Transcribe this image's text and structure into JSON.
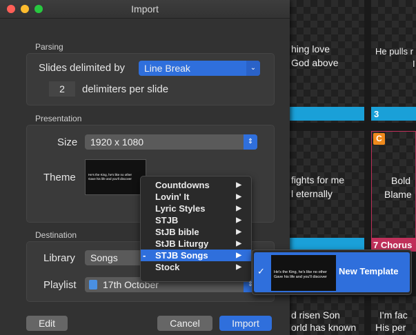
{
  "background": {
    "slides": [
      {
        "line1": "hing love",
        "line2": "God above"
      },
      {
        "line1": "He pulls r",
        "line2": "I"
      },
      {
        "line1": "fights for me",
        "line2": "l eternally"
      },
      {
        "line1": "Bold",
        "line2": "Blame"
      },
      {
        "line1": "d risen Son",
        "line2": "orld has known"
      },
      {
        "line1": "I'm fac",
        "line2": "His per"
      }
    ],
    "slide_number_3": "3",
    "badge_c": "C",
    "chorus_label": "7 Chorus"
  },
  "window": {
    "title": "Import"
  },
  "parsing": {
    "section": "Parsing",
    "slides_delimited_label": "Slides delimited by",
    "delimiter_value": "Line Break",
    "count_value": "2",
    "per_slide_label": "delimiters per slide"
  },
  "presentation": {
    "section": "Presentation",
    "size_label": "Size",
    "size_value": "1920 x 1080",
    "theme_label": "Theme",
    "theme_preview_line1": "He's the King, he's like no other",
    "theme_preview_line2": "Gave his life and you'll discover"
  },
  "destination": {
    "section": "Destination",
    "library_label": "Library",
    "library_value": "Songs",
    "playlist_label": "Playlist",
    "playlist_value": "17th October"
  },
  "buttons": {
    "edit": "Edit",
    "cancel": "Cancel",
    "import": "Import"
  },
  "theme_menu": {
    "items": [
      {
        "label": "Countdowns",
        "submenu": true,
        "selected": false,
        "mark": ""
      },
      {
        "label": "Lovin' It",
        "submenu": true,
        "selected": false,
        "mark": ""
      },
      {
        "label": "Lyric Styles",
        "submenu": true,
        "selected": false,
        "mark": ""
      },
      {
        "label": "STJB",
        "submenu": true,
        "selected": false,
        "mark": ""
      },
      {
        "label": "StJB bible",
        "submenu": true,
        "selected": false,
        "mark": ""
      },
      {
        "label": "StJB Liturgy",
        "submenu": true,
        "selected": false,
        "mark": ""
      },
      {
        "label": "STJB Songs",
        "submenu": true,
        "selected": true,
        "mark": "-"
      },
      {
        "label": "Stock",
        "submenu": true,
        "selected": false,
        "mark": ""
      }
    ],
    "arrow_glyph": "▶"
  },
  "template_submenu": {
    "check": "✓",
    "template_name": "New Template",
    "preview_line1": "He's the King, he's like no other",
    "preview_line2": "Gave his life and you'll discover"
  },
  "colors": {
    "accent": "#2f6fdc",
    "close": "#ff5f57",
    "minimize": "#febc2e",
    "zoom": "#28c840"
  }
}
